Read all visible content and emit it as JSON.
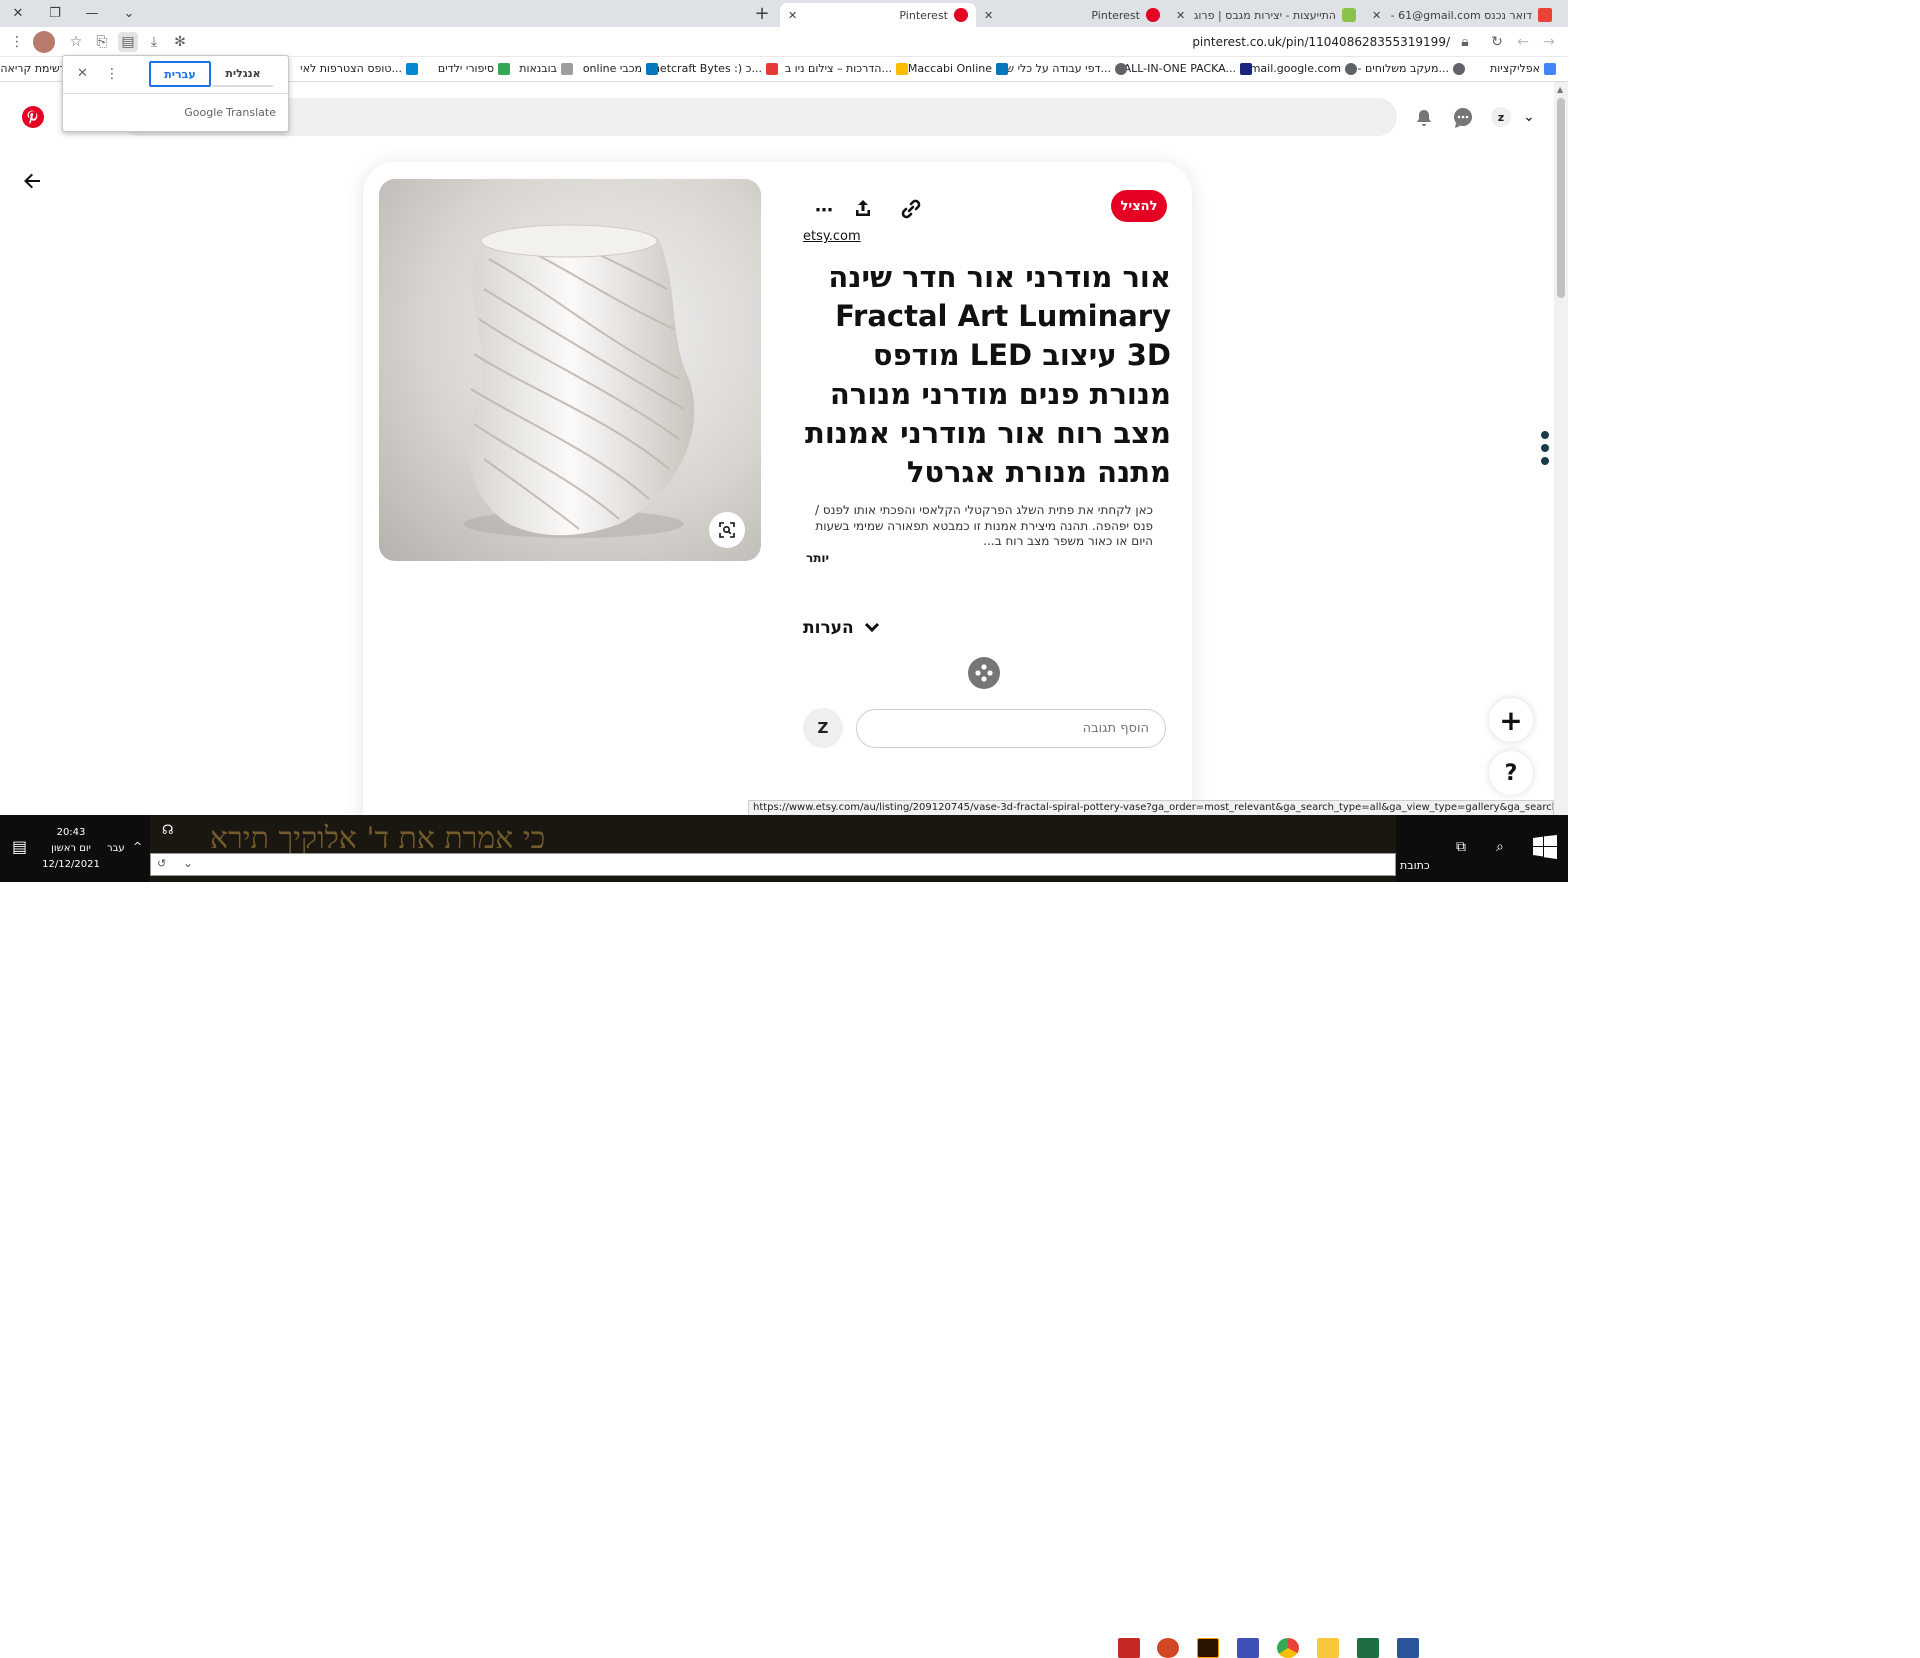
{
  "browser": {
    "tabs": [
      {
        "title": "Pinterest",
        "fav_color": "#e60023",
        "active": true
      },
      {
        "title": "Pinterest",
        "fav_color": "#e60023",
        "active": false
      },
      {
        "title": "התייעצות - יצירות מגבס | פרוג -",
        "fav_color": "#8bc34a",
        "active": false
      },
      {
        "title": "דואר נכנס Gmail - 61@gmail.com",
        "fav_color": "#ea4335",
        "active": false
      }
    ],
    "new_tab": "+",
    "url": "pinterest.co.uk/pin/110408628355319199/",
    "status_link": "https://www.etsy.com/au/listing/209120745/vase-3d-fractal-spiral-pottery-vase?ga_order=most_relevant&ga_search_type=all&ga_view_type=gallery&ga_search_query=&ref=sr_gallery_38"
  },
  "bookmarks": [
    {
      "label": "אפליקציות",
      "color": "#4285f4"
    },
    {
      "label": "מעקב משלוחים - דו...",
      "color": "#5f6368"
    },
    {
      "label": "mail.google.com",
      "color": "#5f6368"
    },
    {
      "label": "ALL-IN-ONE PACKA...",
      "color": "#1a237e"
    },
    {
      "label": "דפי עבודה על כלי שי...",
      "color": "#5f6368"
    },
    {
      "label": "Maccabi Online",
      "color": "#0277bd"
    },
    {
      "label": "הדרכות – צילום ניו ב...",
      "color": "#fbbc04"
    },
    {
      "label": "netcraft Bytes :) כ...",
      "color": "#e53935"
    },
    {
      "label": "online מכבי",
      "color": "#0277bd"
    },
    {
      "label": "בובנאות",
      "color": "#9e9e9e"
    },
    {
      "label": "סיפורי ילדים",
      "color": "#34a853"
    },
    {
      "label": "טופס הצטרפות לאי...",
      "color": "#0288d1"
    },
    {
      "label": "רשימת קריאה",
      "color": "#5f6368"
    }
  ],
  "translate": {
    "lang_en": "אנגלית",
    "lang_he": "עברית",
    "brand": "Google",
    "product": "Translate"
  },
  "pin": {
    "save": "להציל",
    "source": "etsy.com",
    "title": "אור מודרני אור חדר שינה Fractal Art Luminary 3D עיצוב LED מודפס מנורת פנים מודרני מנורה מצב רוח אור מודרני אמנות מתנה מנורת אגרטל",
    "description": "כאן לקחתי את פתית השלג הפרקטלי הקלאסי והפכתי אותו לפנס / פנס יפהפה. תהנה מיצירת אמנות זו כמבטא תפאורה שמימי בשעות היום או כאור משפר מצב רוח ב...",
    "more": "יותר",
    "comments_label": "הערות",
    "avatar_letter": "Z",
    "reply_placeholder": "הוסף תגובה"
  },
  "header": {
    "avatar_letter": "z"
  },
  "fab": {
    "plus": "+",
    "help": "?"
  },
  "taskbar": {
    "time": "20:43",
    "day": "יום ראשון",
    "date": "12/12/2021",
    "lang": "עבר",
    "address_label": "כתובת",
    "bg_text": "כי אמרת את ד' אלוקיך תירא"
  }
}
